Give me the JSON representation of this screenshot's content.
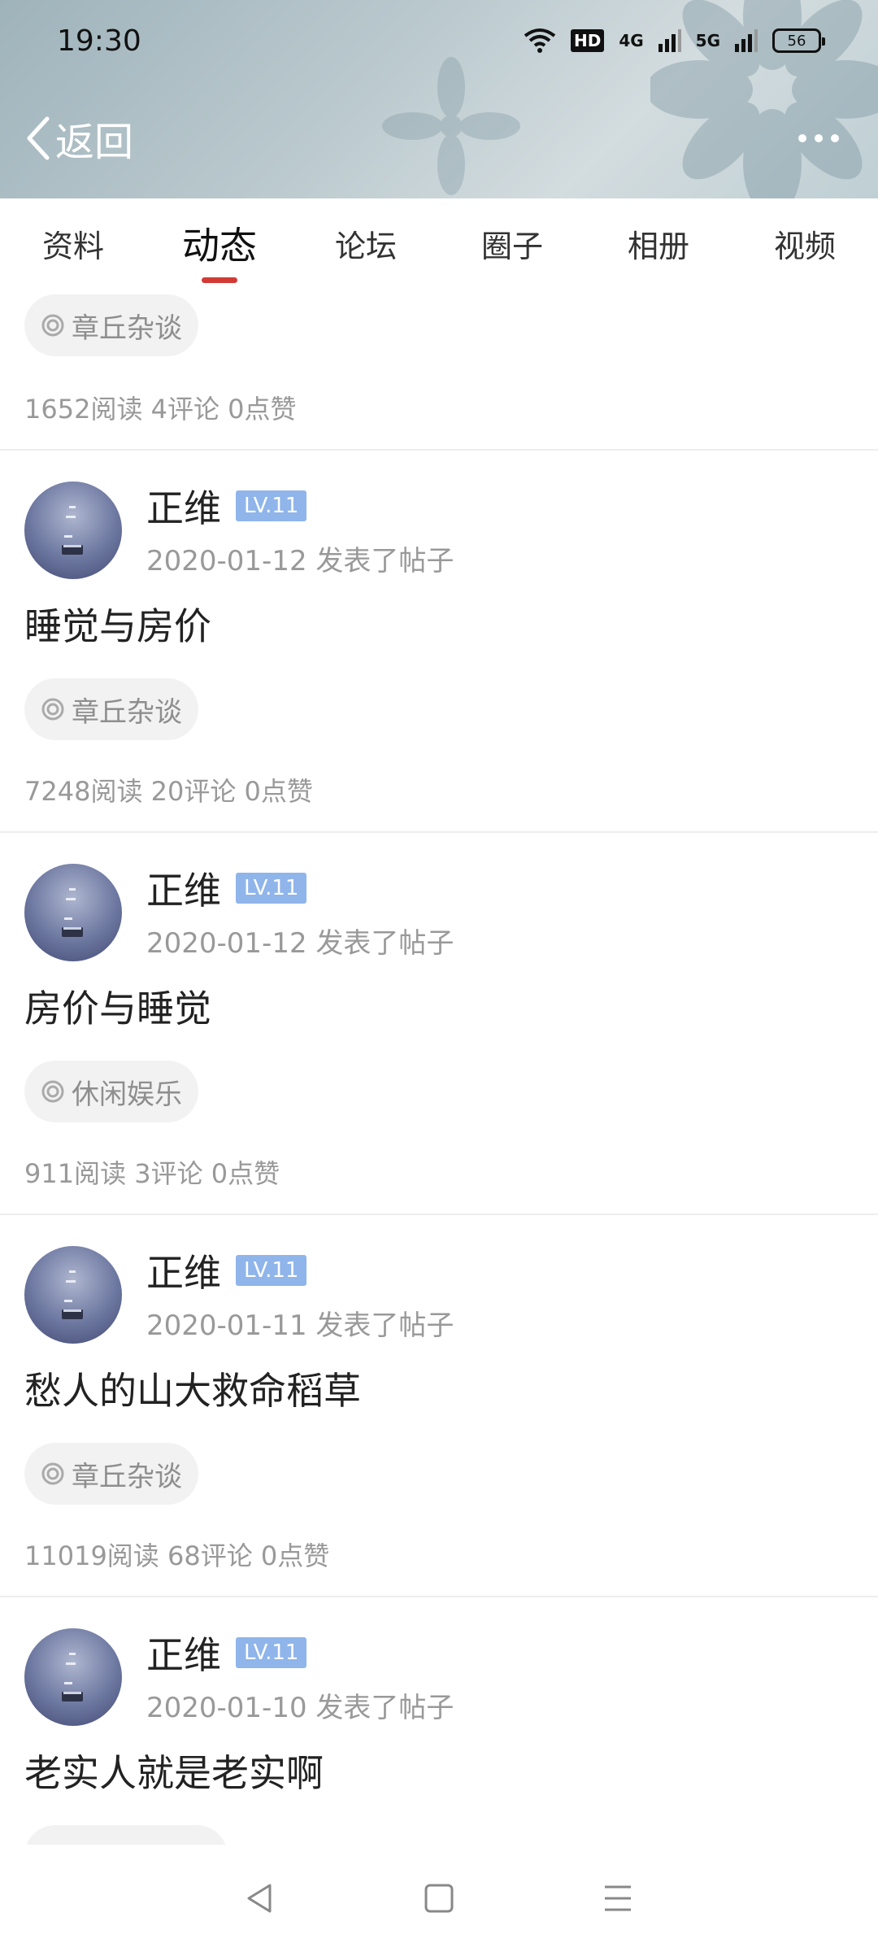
{
  "status_bar": {
    "time": "19:30",
    "hd_label": "HD",
    "net1": "4G",
    "net2": "5G",
    "battery": "56"
  },
  "header": {
    "back_label": "返回",
    "more_icon": "more-dots-icon"
  },
  "tabs": [
    {
      "label": "资料",
      "active": false
    },
    {
      "label": "动态",
      "active": true
    },
    {
      "label": "论坛",
      "active": false
    },
    {
      "label": "圈子",
      "active": false
    },
    {
      "label": "相册",
      "active": false
    },
    {
      "label": "视频",
      "active": false
    }
  ],
  "top_partial": {
    "topic": "章丘杂谈",
    "stats": "1652阅读 4评论 0点赞"
  },
  "posts": [
    {
      "author": "正维",
      "level": "LV.11",
      "meta": "2020-01-12  发表了帖子",
      "title": "睡觉与房价",
      "topic": "章丘杂谈",
      "stats": "7248阅读 20评论 0点赞"
    },
    {
      "author": "正维",
      "level": "LV.11",
      "meta": "2020-01-12  发表了帖子",
      "title": "房价与睡觉",
      "topic": "休闲娱乐",
      "stats": "911阅读 3评论 0点赞"
    },
    {
      "author": "正维",
      "level": "LV.11",
      "meta": "2020-01-11  发表了帖子",
      "title": "愁人的山大救命稻草",
      "topic": "章丘杂谈",
      "stats": "11019阅读 68评论 0点赞"
    },
    {
      "author": "正维",
      "level": "LV.11",
      "meta": "2020-01-10  发表了帖子",
      "title": "老实人就是老实啊"
    }
  ],
  "colors": {
    "accent": "#d23b35",
    "badge": "#8fb5ea",
    "chip_bg": "#f2f2f2",
    "muted_text": "#999999"
  }
}
